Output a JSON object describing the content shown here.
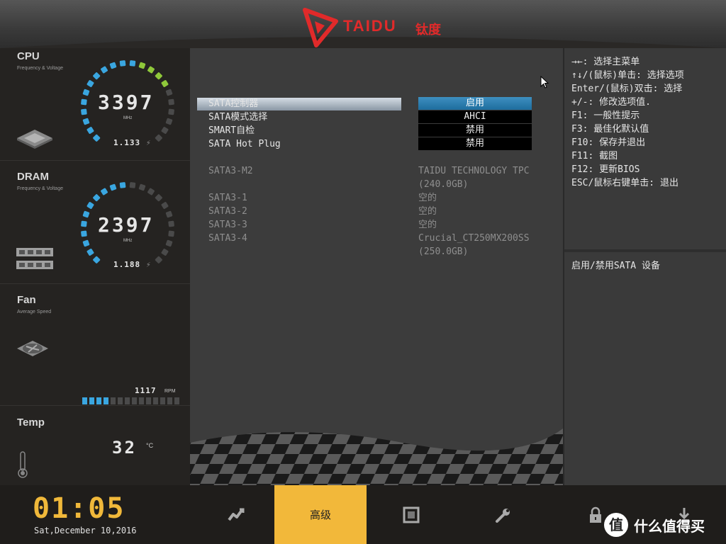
{
  "brand": {
    "name": "TAIDU",
    "name_cn": "钛度"
  },
  "monitor": {
    "cpu": {
      "title": "CPU",
      "subtitle": "Frequency & Voltage",
      "freq": "3397",
      "unit": "MHz",
      "voltage": "1.133"
    },
    "dram": {
      "title": "DRAM",
      "subtitle": "Frequency & Voltage",
      "freq": "2397",
      "unit": "MHz",
      "voltage": "1.188"
    },
    "fan": {
      "title": "Fan",
      "subtitle": "Average Speed",
      "rpm": "1117",
      "rpm_unit": "RPM",
      "level": 0.27
    },
    "temp": {
      "title": "Temp",
      "value": "32",
      "unit": "°C"
    }
  },
  "settings": [
    {
      "label": "SATA控制器",
      "value": "启用",
      "selected": true
    },
    {
      "label": "SATA模式选择",
      "value": "AHCI"
    },
    {
      "label": "SMART自检",
      "value": "禁用"
    },
    {
      "label": "SATA Hot Plug",
      "value": "禁用"
    }
  ],
  "ports": [
    {
      "label": "SATA3-M2",
      "value": "TAIDU TECHNOLOGY TPC",
      "value2": "(240.0GB)"
    },
    {
      "label": "SATA3-1",
      "value": "空的"
    },
    {
      "label": "SATA3-2",
      "value": "空的"
    },
    {
      "label": "SATA3-3",
      "value": "空的"
    },
    {
      "label": "SATA3-4",
      "value": "Crucial_CT250MX200SS",
      "value2": "(250.0GB)"
    }
  ],
  "help": {
    "keys": [
      "→←: 选择主菜单",
      "↑↓/(鼠标)单击: 选择选项",
      "Enter/(鼠标)双击: 选择",
      "+/-: 修改选项值.",
      "F1: 一般性提示",
      "F3: 最佳化默认值",
      "F10: 保存并退出",
      "F11: 截图",
      "F12: 更新BIOS",
      "ESC/鼠标右键单击: 退出"
    ],
    "description": "启用/禁用SATA 设备"
  },
  "clock": {
    "time": "01:05",
    "date": "Sat,December  10,2016"
  },
  "tabs": [
    {
      "name": "overclock",
      "icon": "chart-icon"
    },
    {
      "name": "advanced",
      "label": "高级",
      "active": true
    },
    {
      "name": "chipset",
      "icon": "chip-icon"
    },
    {
      "name": "tools",
      "icon": "wrench-icon"
    },
    {
      "name": "security",
      "icon": "lock-icon"
    },
    {
      "name": "exit",
      "icon": "download-icon"
    }
  ],
  "watermark": {
    "text": "什么值得买",
    "badge": "值"
  },
  "colors": {
    "accent": "#f2b83a",
    "brand": "#e12a2a",
    "gauge": "#3aa6e0",
    "gauge_top": "#8fc83a"
  }
}
